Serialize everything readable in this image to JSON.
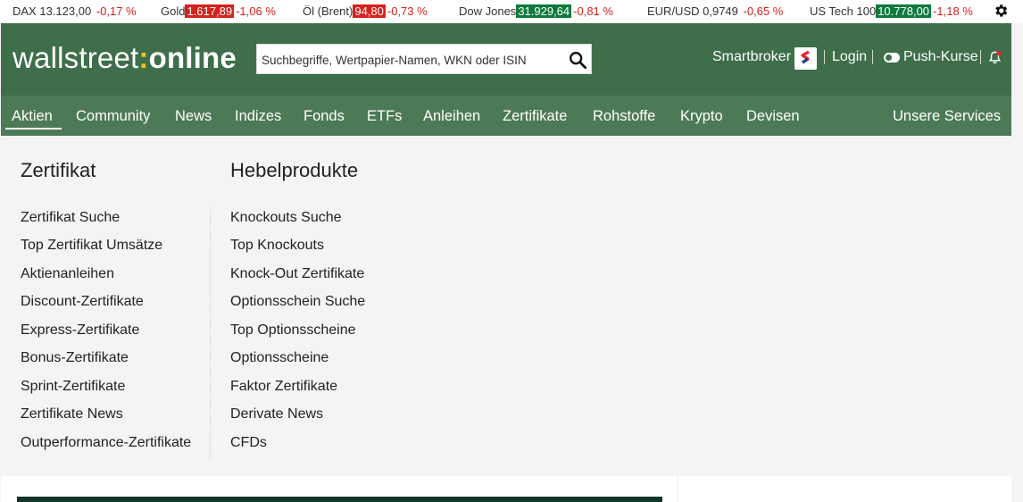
{
  "ticker": [
    {
      "name": "DAX 13.123,00",
      "value": "",
      "change": "-0,17 %"
    },
    {
      "name": "Gold",
      "value": "1.617,89",
      "change": "-1,06 %",
      "box": "red"
    },
    {
      "name": "Öl (Brent)",
      "value": "94,80",
      "change": "-0,73 %",
      "box": "red"
    },
    {
      "name": "Dow Jones",
      "value": "31.929,64",
      "change": "-0,81 %",
      "box": "green"
    },
    {
      "name": "EUR/USD 0,9749",
      "value": "",
      "change": "-0,65 %"
    },
    {
      "name": "US Tech 100",
      "value": "10.778,00",
      "change": "-1,18 %",
      "box": "green"
    }
  ],
  "header": {
    "logo_part1": "wallstreet",
    "logo_colon": ":",
    "logo_part2": "online",
    "search_placeholder": "Suchbegriffe, Wertpapier-Namen, WKN oder ISIN",
    "smartbroker": "Smartbroker",
    "login": "Login",
    "push": "Push-Kurse"
  },
  "nav": {
    "items": [
      "Aktien",
      "Community",
      "News",
      "Indizes",
      "Fonds",
      "ETFs",
      "Anleihen",
      "Zertifikate",
      "Rohstoffe",
      "Krypto",
      "Devisen"
    ],
    "services": "Unsere Services"
  },
  "menu": {
    "col1": {
      "title": "Zertifikat",
      "links": [
        "Zertifikat Suche",
        "Top Zertifikat Umsätze",
        "Aktienanleihen",
        "Discount-Zertifikate",
        "Express-Zertifikate",
        "Bonus-Zertifikate",
        "Sprint-Zertifikate",
        "Zertifikate News",
        "Outperformance-Zertifikate"
      ]
    },
    "col2": {
      "title": "Hebelprodukte",
      "links": [
        "Knockouts Suche",
        "Top Knockouts",
        "Knock-Out Zertifikate",
        "Optionsschein Suche",
        "Top Optionsscheine",
        "Optionsscheine",
        "Faktor Zertifikate",
        "Derivate News",
        "CFDs"
      ]
    }
  },
  "colors": {
    "header_green": "#3f6e4a",
    "nav_green": "#4d7a56",
    "down_red": "#d6221d",
    "up_green": "#0e7a3c",
    "logo_accent": "#f4c21b"
  },
  "icons": [
    "gear-icon",
    "search-icon",
    "smartbroker-logo-icon",
    "toggle-icon",
    "bell-icon"
  ]
}
